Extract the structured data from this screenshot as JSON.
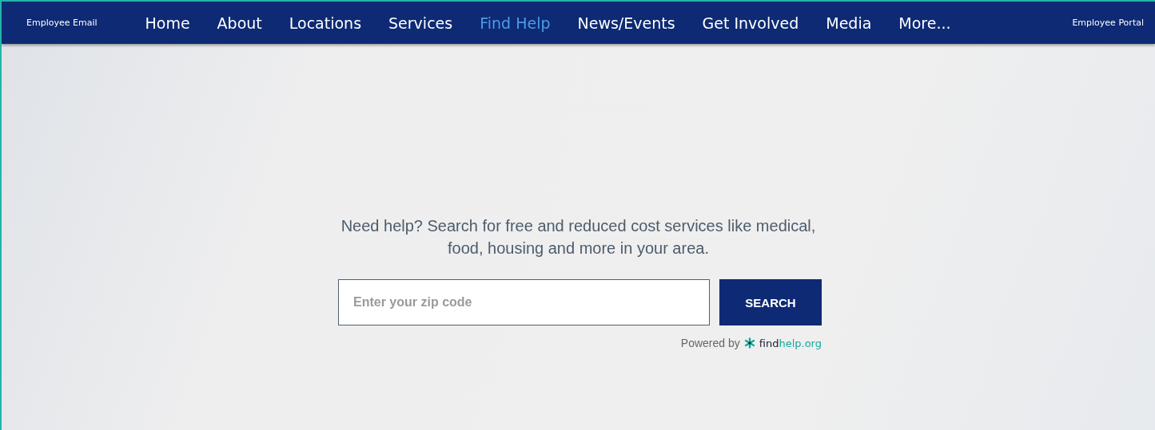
{
  "nav": {
    "left_link": "Employee Email",
    "items": [
      {
        "label": "Home",
        "selected": false
      },
      {
        "label": "About",
        "selected": false
      },
      {
        "label": "Locations",
        "selected": false
      },
      {
        "label": "Services",
        "selected": false
      },
      {
        "label": "Find Help",
        "selected": true
      },
      {
        "label": "News/Events",
        "selected": false
      },
      {
        "label": "Get Involved",
        "selected": false
      },
      {
        "label": "Media",
        "selected": false
      },
      {
        "label": "More...",
        "selected": false
      }
    ],
    "right_link": "Employee Portal"
  },
  "hero": {
    "intro": "Need help? Search for free and reduced cost services like medical, food, housing and more in your area.",
    "search": {
      "placeholder": "Enter your zip code"
    },
    "search_button": "SEARCH",
    "powered_by": "Powered by",
    "logo": {
      "part_1": "find",
      "part_2": "help.org"
    }
  }
}
